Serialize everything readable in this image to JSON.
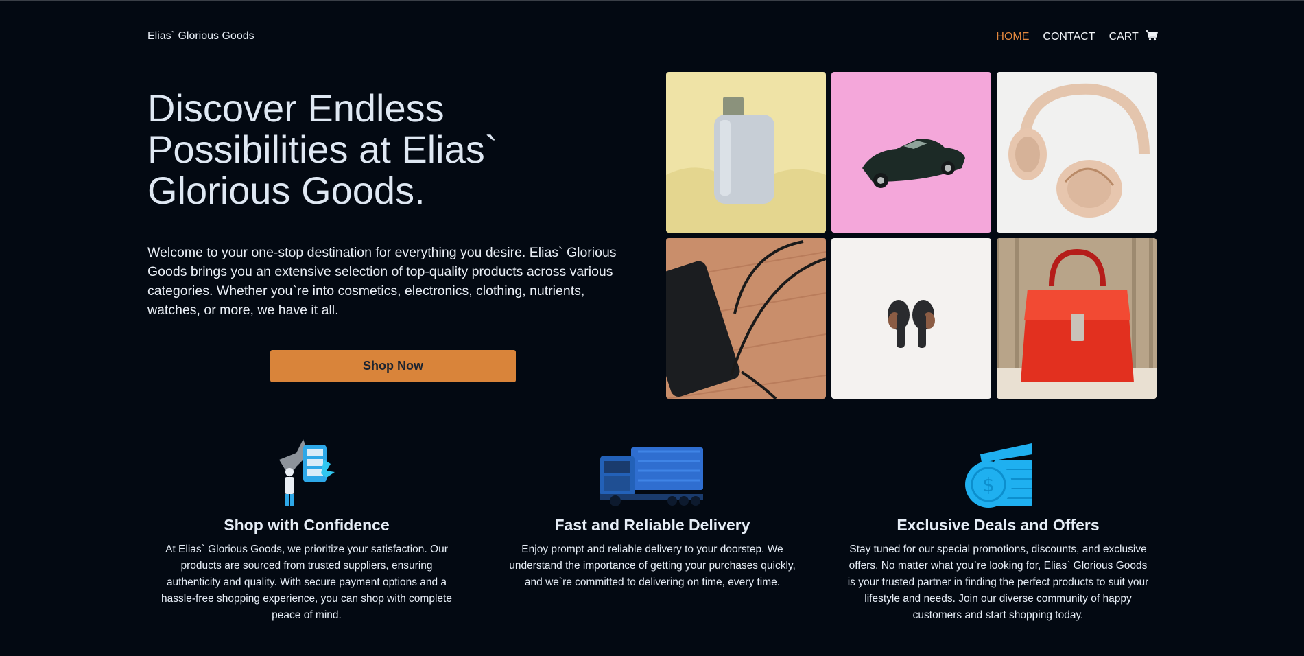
{
  "header": {
    "brand": "Elias` Glorious Goods",
    "nav": [
      {
        "label": "HOME",
        "active": true
      },
      {
        "label": "CONTACT",
        "active": false
      },
      {
        "label": "CART",
        "active": false,
        "icon": "cart-icon"
      }
    ]
  },
  "hero": {
    "title": "Discover Endless Possibilities at Elias` Glorious Goods.",
    "text": "Welcome to your one-stop destination for everything you desire. Elias` Glorious Goods brings you an extensive selection of top-quality products across various categories. Whether you`re into cosmetics, electronics, clothing, nutrients, watches, or more, we have it all.",
    "cta": "Shop Now"
  },
  "products": [
    {
      "icon": "perfume-bottle-image"
    },
    {
      "icon": "toy-car-image"
    },
    {
      "icon": "headphones-image"
    },
    {
      "icon": "power-bank-image"
    },
    {
      "icon": "earbuds-image"
    },
    {
      "icon": "handbag-image"
    }
  ],
  "features": [
    {
      "icon": "shopping-confidence-illustration",
      "title": "Shop with Confidence",
      "text": "At Elias` Glorious Goods, we prioritize your satisfaction. Our products are sourced from trusted suppliers, ensuring authenticity and quality. With secure payment options and a hassle-free shopping experience, you can shop with complete peace of mind."
    },
    {
      "icon": "delivery-truck-illustration",
      "title": "Fast and Reliable Delivery",
      "text": "Enjoy prompt and reliable delivery to your doorstep. We understand the importance of getting your purchases quickly, and we`re committed to delivering on time, every time."
    },
    {
      "icon": "coins-deals-illustration",
      "title": "Exclusive Deals and Offers",
      "text": "Stay tuned for our special promotions, discounts, and exclusive offers. No matter what you`re looking for, Elias` Glorious Goods is your trusted partner in finding the perfect products to suit your lifestyle and needs. Join our diverse community of happy customers and start shopping today."
    }
  ],
  "colors": {
    "background": "#030912",
    "accent": "#d9843a",
    "nav_active": "#e2873e",
    "illustration_blue": "#1fb0f0"
  }
}
